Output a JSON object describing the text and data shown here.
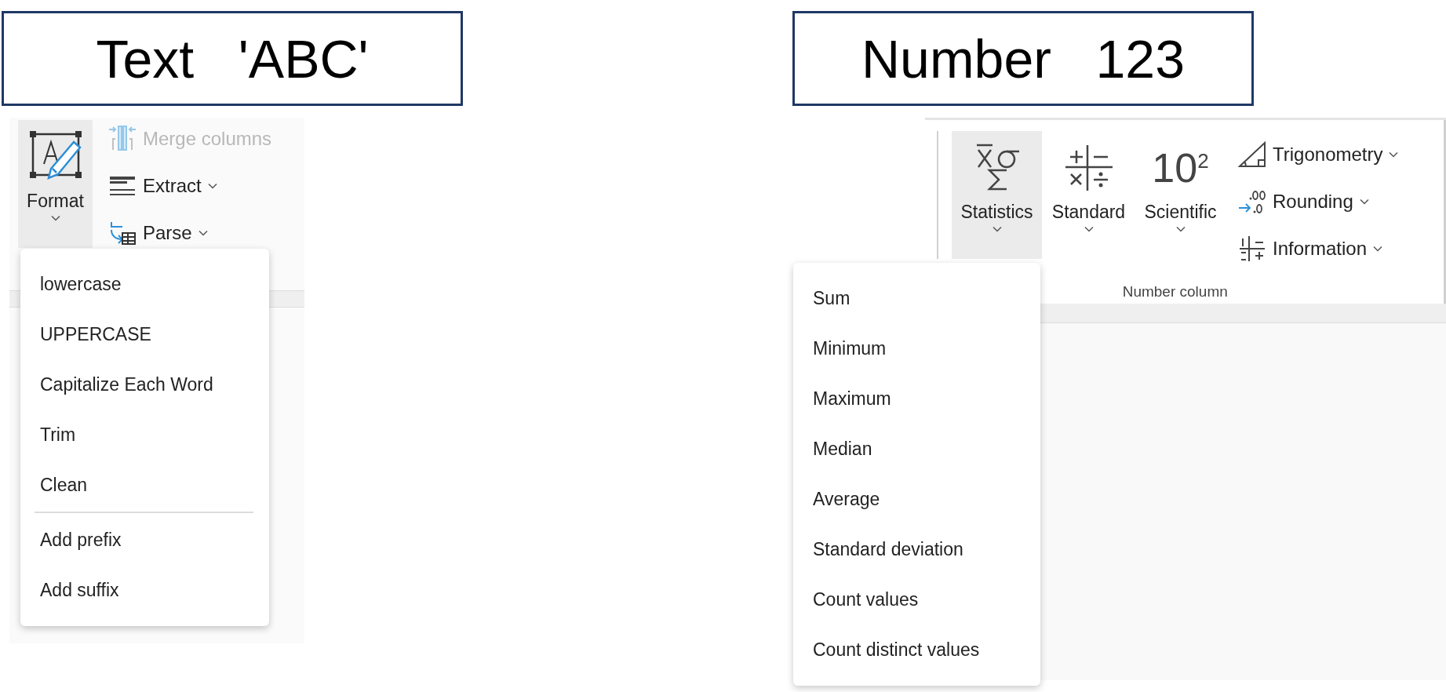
{
  "text_panel": {
    "heading": "Text   'ABC'",
    "ribbon": {
      "large_buttons": [
        {
          "label": "Format",
          "selected": true,
          "dropdown": true
        }
      ],
      "small_buttons": [
        {
          "label": "Merge columns",
          "disabled": true,
          "dropdown": false
        },
        {
          "label": "Extract",
          "disabled": false,
          "dropdown": true
        },
        {
          "label": "Parse",
          "disabled": false,
          "dropdown": true
        }
      ]
    },
    "menu": {
      "groups": [
        {
          "items": [
            "lowercase",
            "UPPERCASE",
            "Capitalize Each Word",
            "Trim",
            "Clean"
          ]
        },
        {
          "items": [
            "Add prefix",
            "Add suffix"
          ]
        }
      ]
    }
  },
  "number_panel": {
    "heading": "Number   123",
    "ribbon": {
      "group_label": "Number column",
      "large_buttons": [
        {
          "label": "Statistics",
          "selected": true,
          "dropdown": true
        },
        {
          "label": "Standard",
          "selected": false,
          "dropdown": true
        },
        {
          "label": "Scientific",
          "selected": false,
          "dropdown": true,
          "icon_text": "10$^{2}$"
        }
      ],
      "small_buttons": [
        {
          "label": "Trigonometry",
          "disabled": false,
          "dropdown": true
        },
        {
          "label": "Rounding",
          "disabled": false,
          "dropdown": true
        },
        {
          "label": "Information",
          "disabled": false,
          "dropdown": true
        }
      ]
    },
    "menu": {
      "groups": [
        {
          "items": [
            "Sum",
            "Minimum",
            "Maximum",
            "Median",
            "Average",
            "Standard deviation",
            "Count values",
            "Count distinct values"
          ]
        }
      ]
    }
  }
}
